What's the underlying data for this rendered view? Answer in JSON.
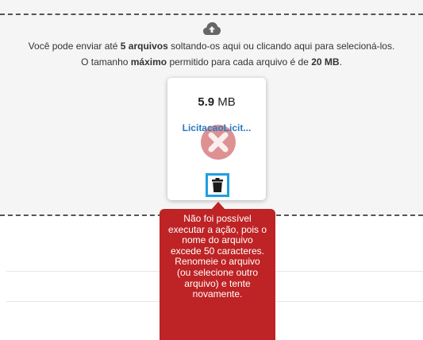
{
  "dropzone": {
    "message_prefix": "Você pode enviar até ",
    "message_max_files": "5 arquivos",
    "message_suffix": " soltando-os aqui ou clicando aqui para selecioná-los.",
    "size_prefix": "O tamanho ",
    "size_keyword": "máximo",
    "size_middle": " permitido para cada arquivo é de ",
    "size_limit": "20 MB",
    "size_end": ".",
    "upload_icon": "cloud-upload-icon"
  },
  "file": {
    "size_value": "5.9",
    "size_unit": " MB",
    "name": "LicitacaoLicit...",
    "status_icon": "error-x-icon",
    "remove_icon": "trash-icon"
  },
  "tooltip": {
    "message": "Não foi possível executar a ação, pois o nome do arquivo excede 50 caracteres. Renomeie o arquivo (ou selecione outro arquivo) e tente novamente."
  },
  "colors": {
    "error": "#be2325",
    "link": "#2a78c0",
    "highlight": "#1e9fe0"
  }
}
